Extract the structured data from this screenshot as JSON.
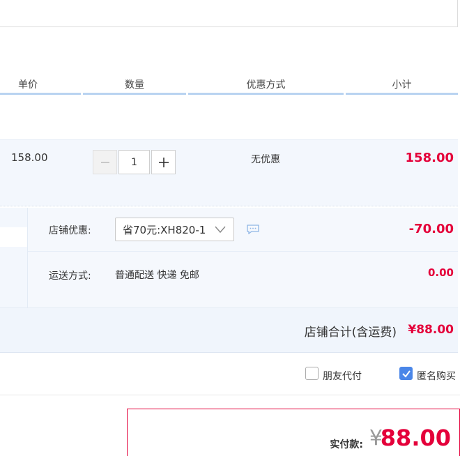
{
  "columns": {
    "unit_price": "单价",
    "quantity": "数量",
    "promotion": "优惠方式",
    "subtotal": "小计"
  },
  "item": {
    "price": "158.00",
    "quantity": "1",
    "promotion": "无优惠",
    "subtotal": "158.00",
    "minus_icon": "minus-icon",
    "plus_icon": "plus-icon"
  },
  "shop": {
    "coupon_label": "店铺优惠:",
    "coupon_selected": "省70元:XH820-1",
    "coupon_discount": "-70.00",
    "shipping_label": "运送方式:",
    "shipping_value": "普通配送 快递 免邮",
    "shipping_fee": "0.00",
    "total_label": "店铺合计(含运费)",
    "total_value": "¥88.00"
  },
  "options": {
    "friend_pay": "朋友代付",
    "friend_pay_checked": false,
    "anonymous": "匿名购买",
    "anonymous_checked": true
  },
  "payment": {
    "label": "实付款:",
    "currency": "¥",
    "amount": "88.00"
  },
  "colors": {
    "price_red": "#e4003a",
    "header_line": "#b9d3f1",
    "row_bg": "#f3f7fd",
    "checkbox_blue": "#4a86e8"
  }
}
